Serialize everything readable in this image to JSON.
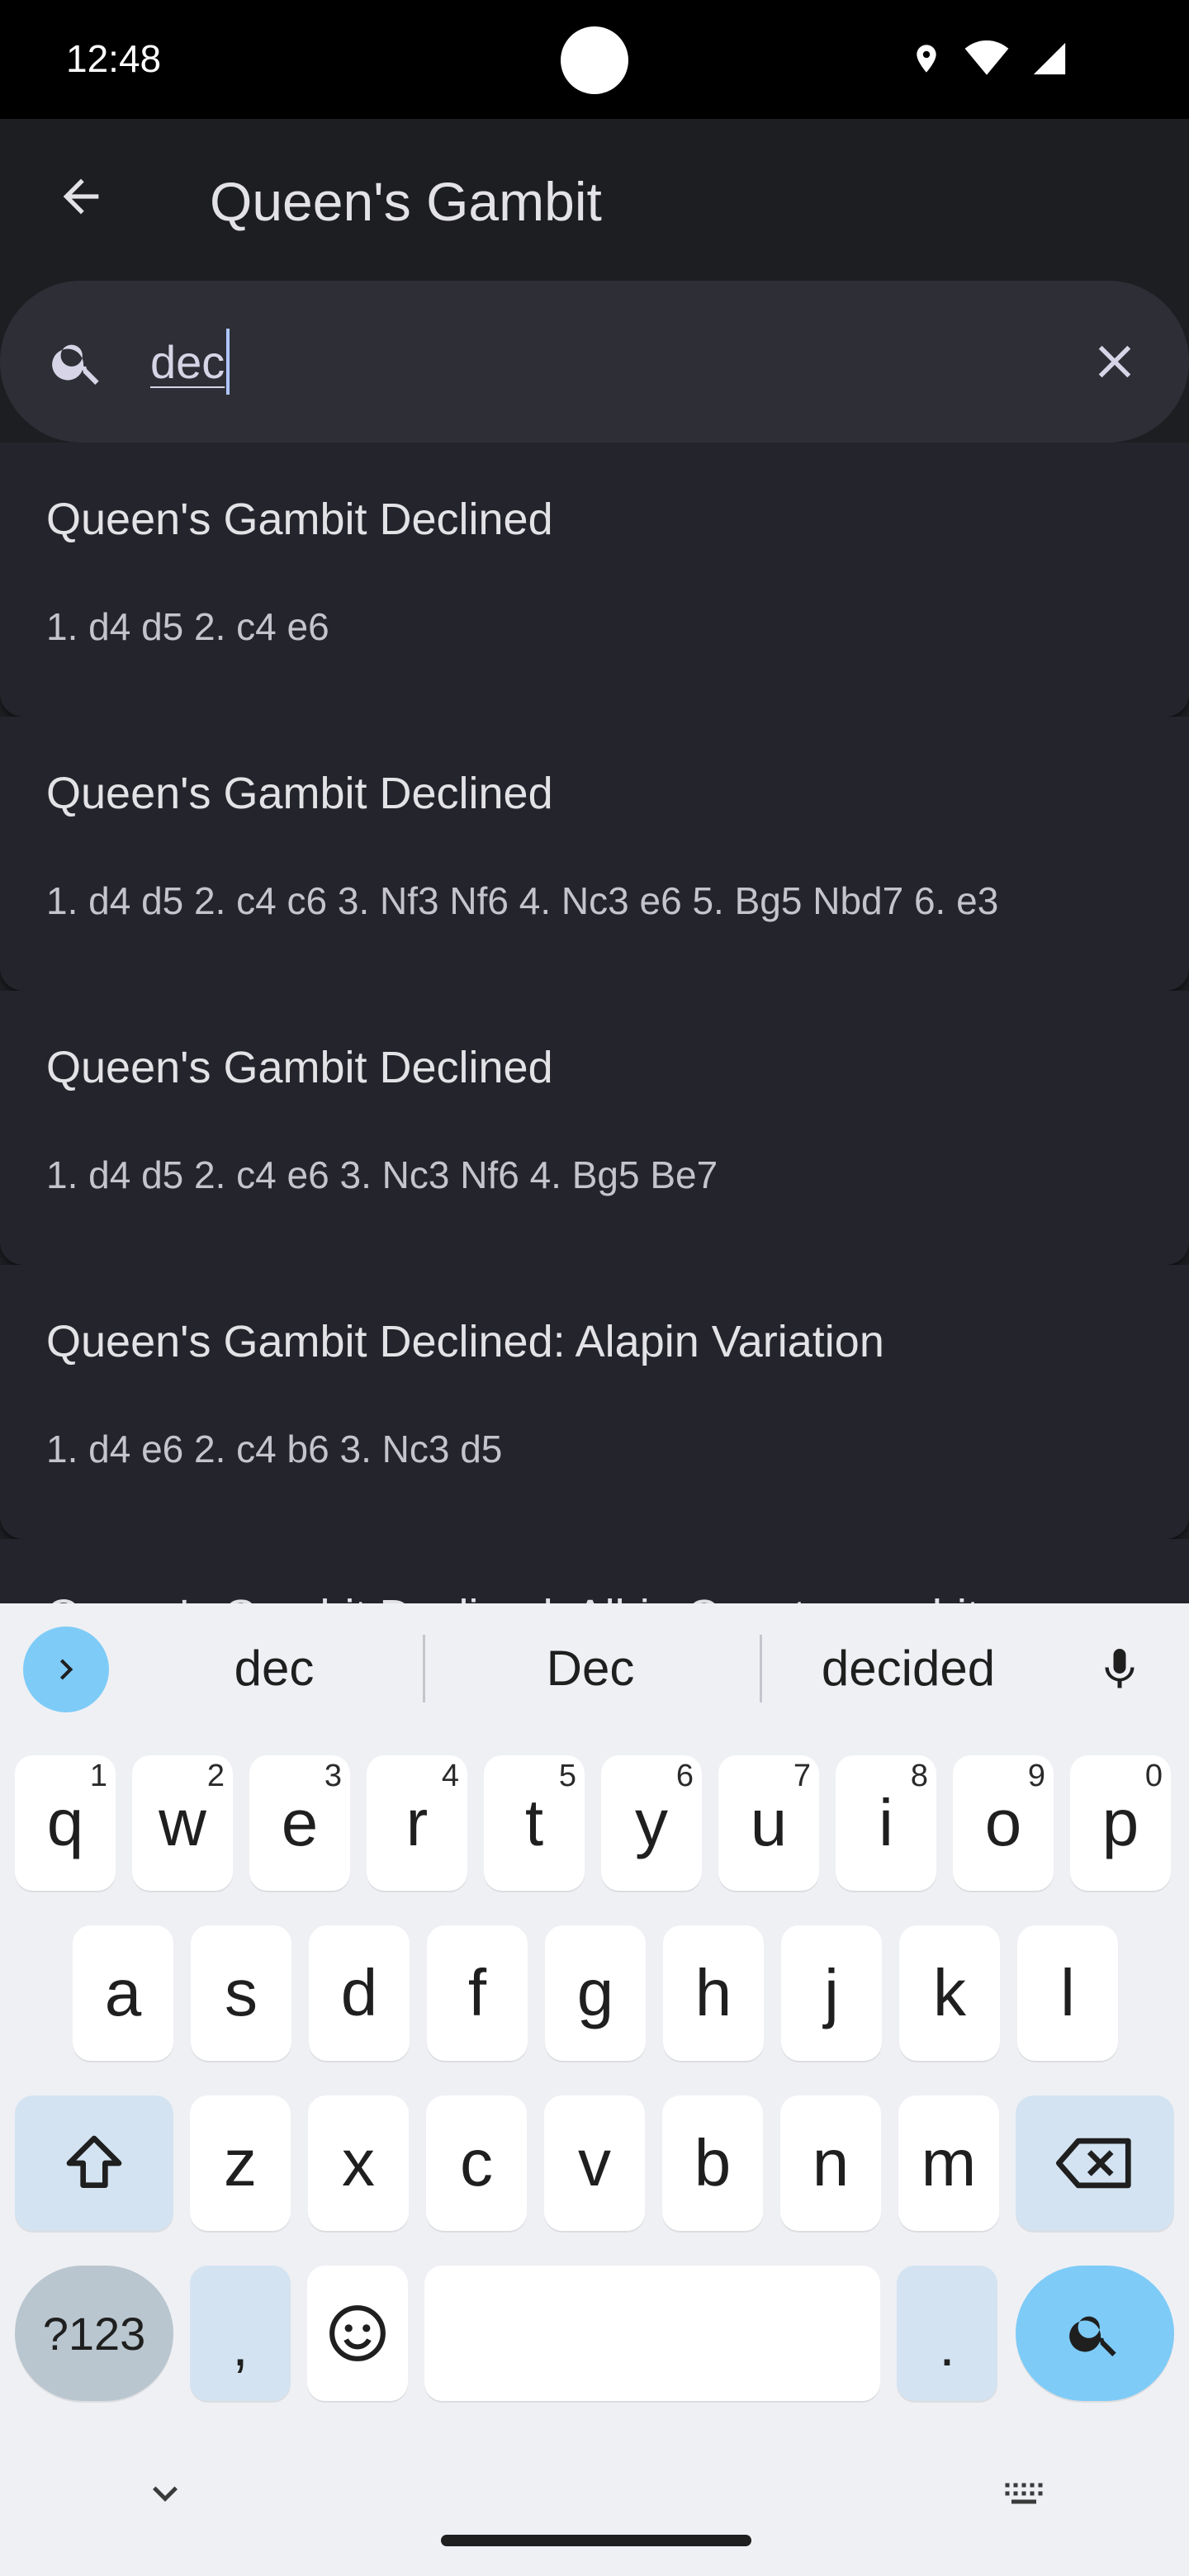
{
  "status_bar": {
    "time": "12:48",
    "icons": [
      "location-icon",
      "wifi-icon",
      "signal-icon"
    ]
  },
  "app_bar": {
    "title": "Queen's Gambit",
    "back_icon": "arrow-left-icon"
  },
  "search": {
    "value": "dec",
    "search_icon": "search-icon",
    "clear_icon": "close-icon"
  },
  "results": [
    {
      "name": "Queen's Gambit Declined",
      "moves": "1. d4 d5 2. c4 e6"
    },
    {
      "name": "Queen's Gambit Declined",
      "moves": "1. d4 d5 2. c4 c6 3. Nf3 Nf6 4. Nc3 e6 5. Bg5 Nbd7 6. e3"
    },
    {
      "name": "Queen's Gambit Declined",
      "moves": "1. d4 d5 2. c4 e6 3. Nc3 Nf6 4. Bg5 Be7"
    },
    {
      "name": "Queen's Gambit Declined: Alapin Variation",
      "moves": "1. d4 e6 2. c4 b6 3. Nc3 d5"
    },
    {
      "name": "Queen's Gambit Declined: Albin Countergambit",
      "moves": ""
    }
  ],
  "keyboard": {
    "suggestions": [
      "dec",
      "Dec",
      "decided"
    ],
    "row1": [
      {
        "k": "q",
        "h": "1"
      },
      {
        "k": "w",
        "h": "2"
      },
      {
        "k": "e",
        "h": "3"
      },
      {
        "k": "r",
        "h": "4"
      },
      {
        "k": "t",
        "h": "5"
      },
      {
        "k": "y",
        "h": "6"
      },
      {
        "k": "u",
        "h": "7"
      },
      {
        "k": "i",
        "h": "8"
      },
      {
        "k": "o",
        "h": "9"
      },
      {
        "k": "p",
        "h": "0"
      }
    ],
    "row2": [
      "a",
      "s",
      "d",
      "f",
      "g",
      "h",
      "j",
      "k",
      "l"
    ],
    "row3": [
      "z",
      "x",
      "c",
      "v",
      "b",
      "n",
      "m"
    ],
    "symbols_label": "?123",
    "comma": ",",
    "period": ".",
    "colors": {
      "accent": "#7ecbf7",
      "modifier": "#d3e3f1",
      "background": "#eff0f4"
    }
  },
  "colors": {
    "app_background": "#1d1e22",
    "card": "#24252c",
    "search_bar": "#2e2f36"
  }
}
